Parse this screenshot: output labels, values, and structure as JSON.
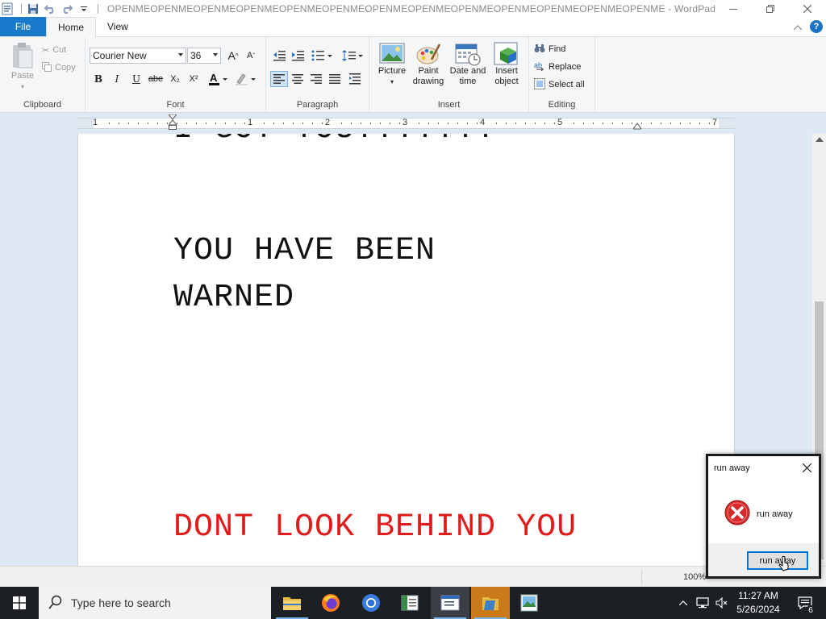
{
  "window": {
    "title": "OPENMEOPENMEOPENMEOPENMEOPENMEOPENMEOPENMEOPENMEOPENMEOPENMEOPENMEOPENMEOPENME - WordPad"
  },
  "tabs": {
    "file": "File",
    "home": "Home",
    "view": "View"
  },
  "clipboard": {
    "paste": "Paste",
    "cut": "Cut",
    "copy": "Copy",
    "label": "Clipboard"
  },
  "font": {
    "family": "Courier New",
    "size": "36",
    "label": "Font",
    "bold": "B",
    "italic": "I",
    "underline": "U",
    "strike": "abe",
    "subscript": "X₂",
    "superscript": "X²",
    "grow": "A",
    "shrink": "A"
  },
  "paragraph": {
    "label": "Paragraph"
  },
  "insert": {
    "label": "Insert",
    "picture": "Picture",
    "paint_line1": "Paint",
    "paint_line2": "drawing",
    "date_line1": "Date and",
    "date_line2": "time",
    "object_line1": "Insert",
    "object_line2": "object"
  },
  "editing": {
    "label": "Editing",
    "find": "Find",
    "replace": "Replace",
    "select_all": "Select all"
  },
  "ruler": {
    "numbers": [
      "1",
      "1",
      "2",
      "3",
      "4",
      "5",
      "7"
    ]
  },
  "document": {
    "line_partial": "I GOT YOU!!!!!!!",
    "line1": "YOU HAVE BEEN",
    "line2": "WARNED",
    "line3": "DONT LOOK BEHIND YOU",
    "accent_red": "#e01b1b"
  },
  "status": {
    "zoom": "100%"
  },
  "dialog": {
    "title": "run away",
    "message": "run away",
    "button": "run away",
    "icon": "error-icon"
  },
  "taskbar": {
    "search_placeholder": "Type here to search",
    "time": "11:27 AM",
    "date": "5/26/2024",
    "notifications": "6"
  }
}
